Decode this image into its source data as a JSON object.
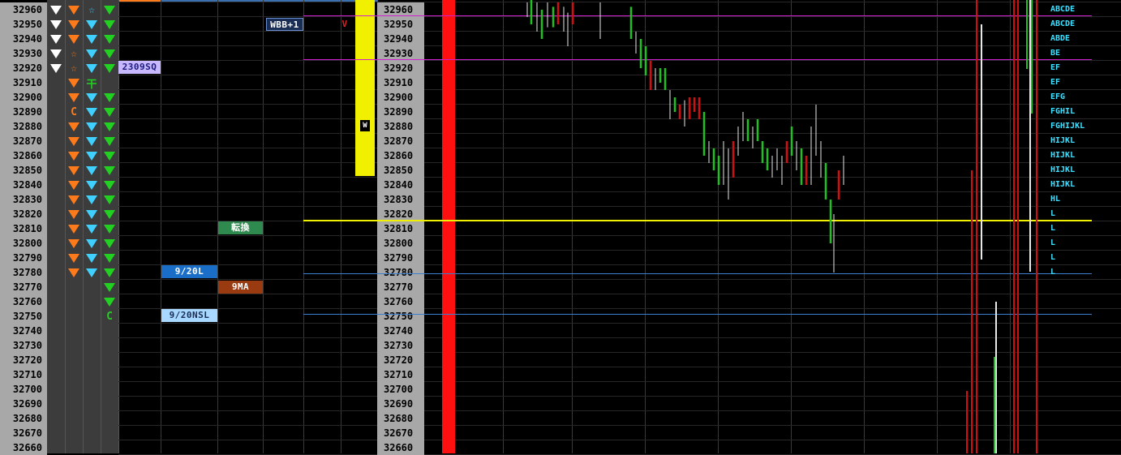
{
  "ladder": {
    "prices": [
      "32960",
      "32950",
      "32940",
      "32930",
      "32920",
      "32910",
      "32900",
      "32890",
      "32880",
      "32870",
      "32860",
      "32850",
      "32840",
      "32830",
      "32820",
      "32810",
      "32800",
      "32790",
      "32780",
      "32770",
      "32760",
      "32750",
      "32740",
      "32730",
      "32720",
      "32710",
      "32700",
      "32690",
      "32680",
      "32670",
      "32660"
    ],
    "col1": [
      "w",
      "w",
      "w",
      "w",
      "w",
      "",
      "",
      "",
      "",
      "",
      "",
      "",
      "",
      "",
      "",
      "",
      "",
      "",
      "",
      "",
      "",
      "",
      "",
      "",
      "",
      "",
      "",
      "",
      "",
      "",
      ""
    ],
    "col2": [
      "o",
      "o",
      "o",
      "star-o",
      "star-o",
      "o",
      "o",
      "C",
      "o",
      "o",
      "o",
      "o",
      "o",
      "o",
      "o",
      "o",
      "o",
      "o",
      "o",
      "",
      "",
      "",
      "",
      "",
      "",
      "",
      "",
      "",
      "",
      "",
      ""
    ],
    "col3": [
      "star-c",
      "c",
      "c",
      "c",
      "c",
      "kanji",
      "c",
      "c",
      "c",
      "c",
      "c",
      "c",
      "c",
      "c",
      "c",
      "c",
      "c",
      "c",
      "c",
      "",
      "",
      "",
      "",
      "",
      "",
      "",
      "",
      "",
      "",
      "",
      ""
    ],
    "col4": [
      "g",
      "g",
      "g",
      "g",
      "g",
      "",
      "g",
      "g",
      "g",
      "g",
      "g",
      "g",
      "g",
      "g",
      "g",
      "g",
      "g",
      "g",
      "g",
      "g",
      "g",
      "C",
      "",
      "",
      "",
      "",
      "",
      "",
      "",
      "",
      ""
    ],
    "kanji_glyph": "干",
    "c_glyph": "C",
    "star_glyph": "☆"
  },
  "tags": {
    "wbb": "WBB+1",
    "v_marker": "V",
    "w_marker": "W",
    "sq": "2309SQ",
    "tenkan": "転換",
    "l920": "9/20L",
    "ma9": "9MA",
    "nsl920": "9/20NSL"
  },
  "tpo": [
    "ABCDE",
    "ABCDE",
    "ABDE",
    "BE",
    "EF",
    "EF",
    "EFG",
    "FGHIL",
    "FGHIJKL",
    "HIJKL",
    "HIJKL",
    "HIJKL",
    "HIJKL",
    "HL",
    "L",
    "L",
    "L",
    "L",
    "L"
  ],
  "colors": {
    "magenta": "#d020d0",
    "yellow": "#f0f000",
    "blue_line": "#3a7fd0",
    "red_bar": "#ff1010",
    "tpo_text": "#3fe0ff"
  }
}
